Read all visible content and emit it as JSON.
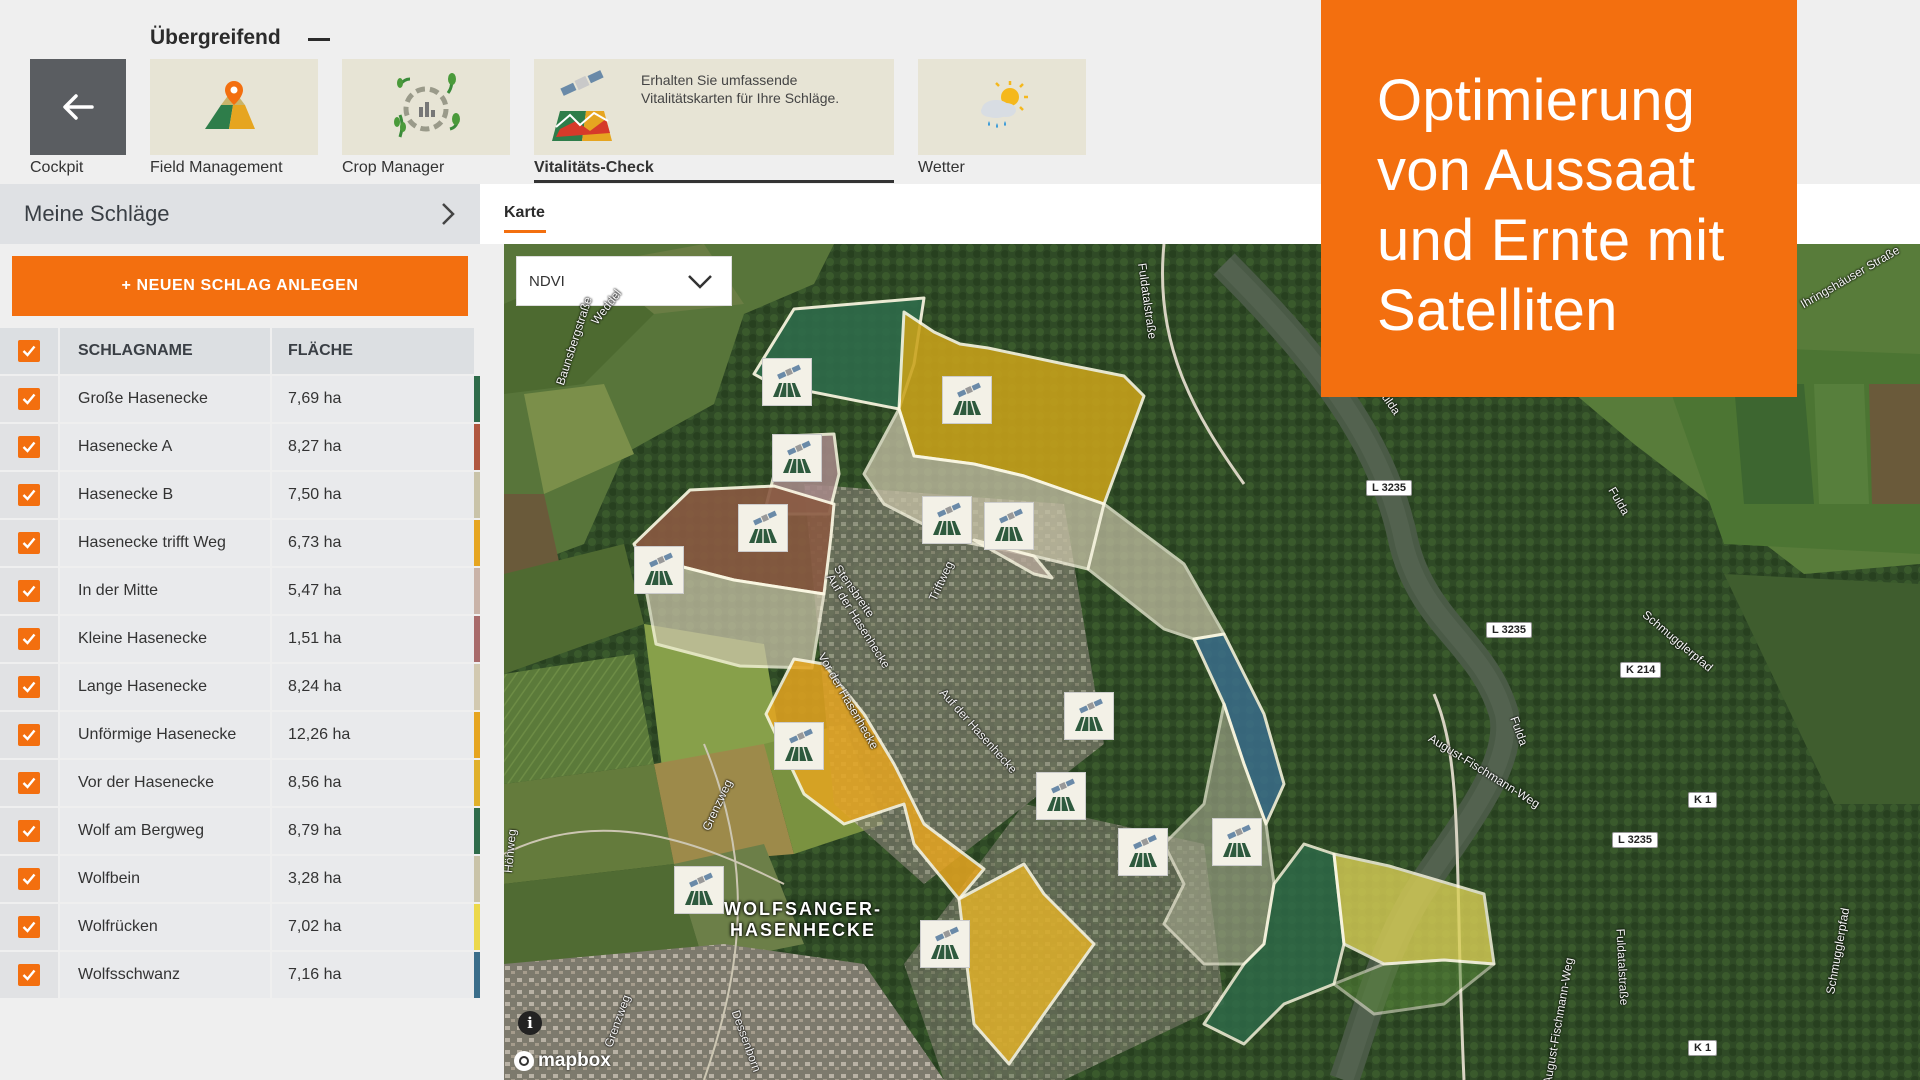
{
  "nav": {
    "group_title": "Übergreifend",
    "back_label": "Cockpit",
    "tiles": [
      {
        "label": "Field Management",
        "icon": "map-pin-icon"
      },
      {
        "label": "Crop Manager",
        "icon": "crop-cycle-icon"
      },
      {
        "label": "Vitalitäts-Check",
        "icon": "satellite-map-icon",
        "description": "Erhalten Sie umfassende Vitalitätskarten für Ihre Schläge.",
        "active": true
      },
      {
        "label": "Wetter",
        "icon": "weather-icon"
      }
    ]
  },
  "promo": {
    "lines": [
      "Optimierung",
      "von Aussaat",
      "und Ernte mit",
      "Satelliten"
    ]
  },
  "sidebar": {
    "header": "Meine Schläge",
    "new_button": "+ NEUEN SCHLAG ANLEGEN",
    "columns": {
      "name": "SCHLAGNAME",
      "area": "FLÄCHE"
    },
    "rows": [
      {
        "name": "Große Hasenecke",
        "area": "7,69 ha",
        "color": "#2e6b4a"
      },
      {
        "name": "Hasenecke A",
        "area": "8,27 ha",
        "color": "#b0573f"
      },
      {
        "name": "Hasenecke B",
        "area": "7,50 ha",
        "color": "#c9c3a8"
      },
      {
        "name": "Hasenecke trifft Weg",
        "area": "6,73 ha",
        "color": "#e6a520"
      },
      {
        "name": "In der Mitte",
        "area": "5,47 ha",
        "color": "#c9b3a8"
      },
      {
        "name": "Kleine Hasenecke",
        "area": "1,51 ha",
        "color": "#a86a6a"
      },
      {
        "name": "Lange Hasenecke",
        "area": "8,24 ha",
        "color": "#d2c9b0"
      },
      {
        "name": "Unförmige Hasenecke",
        "area": "12,26 ha",
        "color": "#e6a520"
      },
      {
        "name": "Vor der Hasenecke",
        "area": "8,56 ha",
        "color": "#e0b02a"
      },
      {
        "name": "Wolf am Bergweg",
        "area": "8,79 ha",
        "color": "#2e6b4a"
      },
      {
        "name": "Wolfbein",
        "area": "3,28 ha",
        "color": "#c9c3a8"
      },
      {
        "name": "Wolfrücken",
        "area": "7,02 ha",
        "color": "#ecd84a"
      },
      {
        "name": "Wolfsschwanz",
        "area": "7,16 ha",
        "color": "#3a6d8a"
      }
    ]
  },
  "map": {
    "tab": "Karte",
    "layer": "NDVI",
    "district": [
      "WOLFSANGER-",
      "HASENHECKE"
    ],
    "attribution": "mapbox",
    "info": "i",
    "road_labels": [
      "L 3235",
      "L 3235",
      "K 214",
      "K 1",
      "L 3235",
      "K 1"
    ],
    "streets": [
      "Weddel",
      "Baunsbergstraße",
      "Fuldatalstraße",
      "Stensbreite",
      "Auf der Hasenhecke",
      "Triftweg",
      "Vor der Hasenhecke",
      "Auf der Hasenhecke",
      "Grenzweg",
      "Höhweg",
      "Grenzweg",
      "Dessenborn",
      "Fulda",
      "Fulda",
      "Schmugglerpfad",
      "August-Fischmann-Weg",
      "Fuldatalstraße",
      "August-Fischmann-Weg",
      "Schmugglerpfad",
      "Ihringshäuser Straße",
      "Fulda"
    ]
  }
}
